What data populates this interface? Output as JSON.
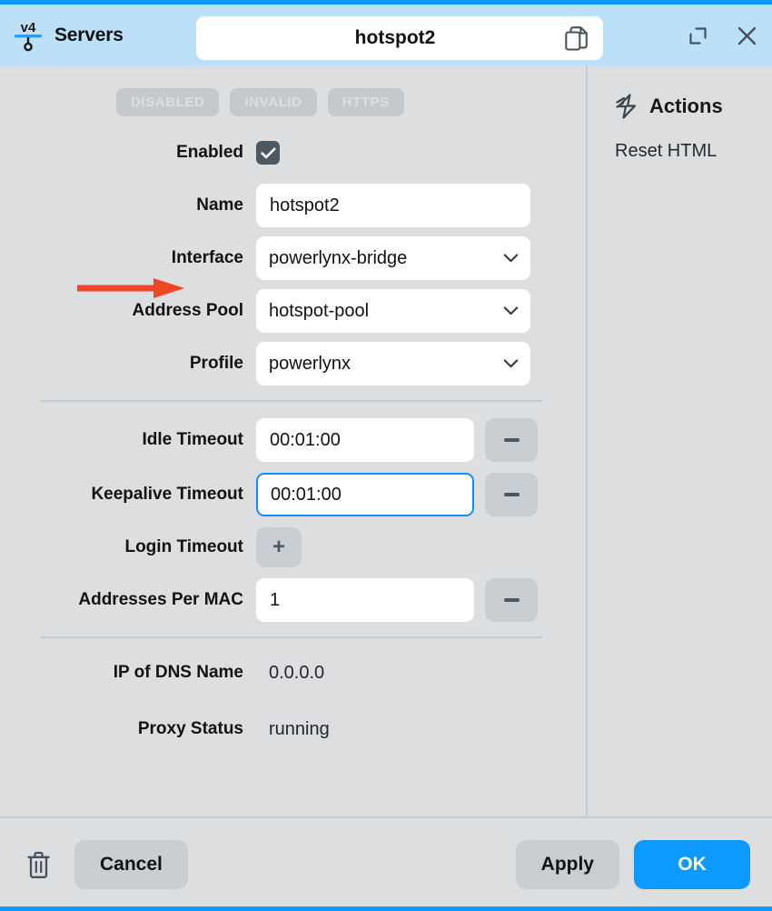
{
  "window": {
    "app_label": "Servers",
    "logo_icon": "ipv4-network-icon",
    "title_value": "hotspot2",
    "copy_icon": "copy-documents-icon",
    "maximize_icon": "maximize-icon",
    "close_icon": "close-icon",
    "accent_color": "#0d99ff",
    "titlebar_color": "#bbe0f7"
  },
  "badges": [
    {
      "label": "DISABLED",
      "state": "inactive"
    },
    {
      "label": "INVALID",
      "state": "inactive"
    },
    {
      "label": "HTTPS",
      "state": "inactive"
    }
  ],
  "form": {
    "enabled": {
      "label": "Enabled",
      "checked": true,
      "check_icon": "checkmark-icon"
    },
    "name": {
      "label": "Name",
      "value": "hotspot2",
      "placeholder": ""
    },
    "interface": {
      "label": "Interface",
      "value": "powerlynx-bridge",
      "options": [
        "powerlynx-bridge"
      ]
    },
    "address_pool": {
      "label": "Address Pool",
      "value": "hotspot-pool",
      "options": [
        "hotspot-pool"
      ]
    },
    "profile": {
      "label": "Profile",
      "value": "powerlynx",
      "options": [
        "powerlynx"
      ]
    },
    "idle_timeout": {
      "label": "Idle Timeout",
      "value": "00:01:00",
      "placeholder": "",
      "step_glyph": "-",
      "focused": false
    },
    "keepalive_timeout": {
      "label": "Keepalive Timeout",
      "value": "00:01:00",
      "placeholder": "",
      "step_glyph": "-",
      "focused": true
    },
    "login_timeout": {
      "label": "Login Timeout",
      "step_glyph": "+"
    },
    "addresses_per_mac": {
      "label": "Addresses Per MAC",
      "value": "1",
      "placeholder": "",
      "step_glyph": "-",
      "focused": false
    },
    "ip_of_dns_name": {
      "label": "IP of DNS Name",
      "value": "0.0.0.0"
    },
    "proxy_status": {
      "label": "Proxy Status",
      "value": "running"
    }
  },
  "actions": {
    "icon": "lightning-bolt-icon",
    "title": "Actions",
    "items": [
      {
        "label": "Reset HTML"
      }
    ]
  },
  "footer": {
    "delete_icon": "trash-icon",
    "cancel_label": "Cancel",
    "apply_label": "Apply",
    "ok_label": "OK",
    "primary_color": "#0d99ff"
  },
  "annotation": {
    "arrow_color": "#f04623",
    "points_at": "Name"
  }
}
